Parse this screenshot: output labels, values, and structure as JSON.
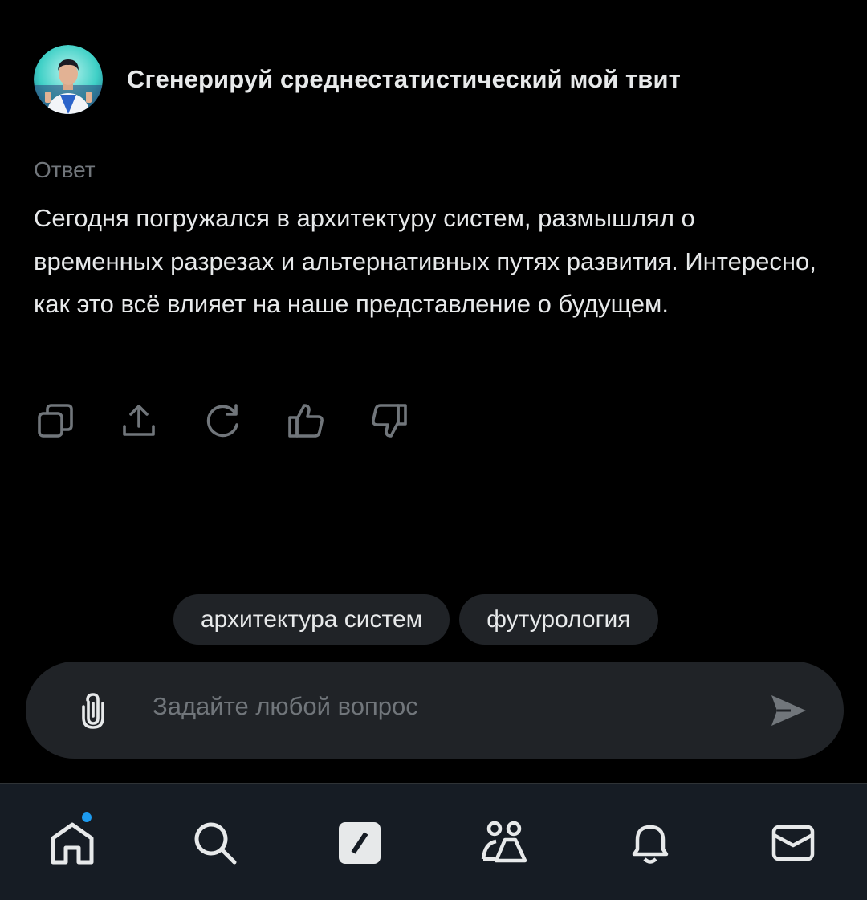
{
  "question": {
    "text": "Сгенерируй среднестатистический мой твит",
    "avatar_icon": "user-avatar"
  },
  "answer": {
    "label": "Ответ",
    "text": "Сегодня погружался в архитектуру систем, размышлял о временных разрезах и альтернативных путях развития. Интересно, как это всё влияет на наше представление о будущем."
  },
  "actions": [
    {
      "name": "copy",
      "icon": "copy-icon"
    },
    {
      "name": "share",
      "icon": "share-icon"
    },
    {
      "name": "regenerate",
      "icon": "refresh-icon"
    },
    {
      "name": "like",
      "icon": "thumbs-up-icon"
    },
    {
      "name": "dislike",
      "icon": "thumbs-down-icon"
    }
  ],
  "suggestions": [
    {
      "label": "архитектура систем"
    },
    {
      "label": "футурология"
    }
  ],
  "input": {
    "placeholder": "Задайте любой вопрос",
    "attach_icon": "paperclip-icon",
    "send_icon": "send-icon"
  },
  "nav": [
    {
      "name": "home",
      "icon": "home-icon",
      "has_badge": true
    },
    {
      "name": "search",
      "icon": "search-icon"
    },
    {
      "name": "grok",
      "icon": "grok-icon"
    },
    {
      "name": "communities",
      "icon": "people-icon"
    },
    {
      "name": "notifications",
      "icon": "bell-icon"
    },
    {
      "name": "messages",
      "icon": "mail-icon"
    }
  ],
  "colors": {
    "background": "#000000",
    "text": "#e7e9ea",
    "muted": "#71767b",
    "surface": "#202327",
    "nav_bg": "#161c24",
    "accent": "#1d9bf0"
  }
}
